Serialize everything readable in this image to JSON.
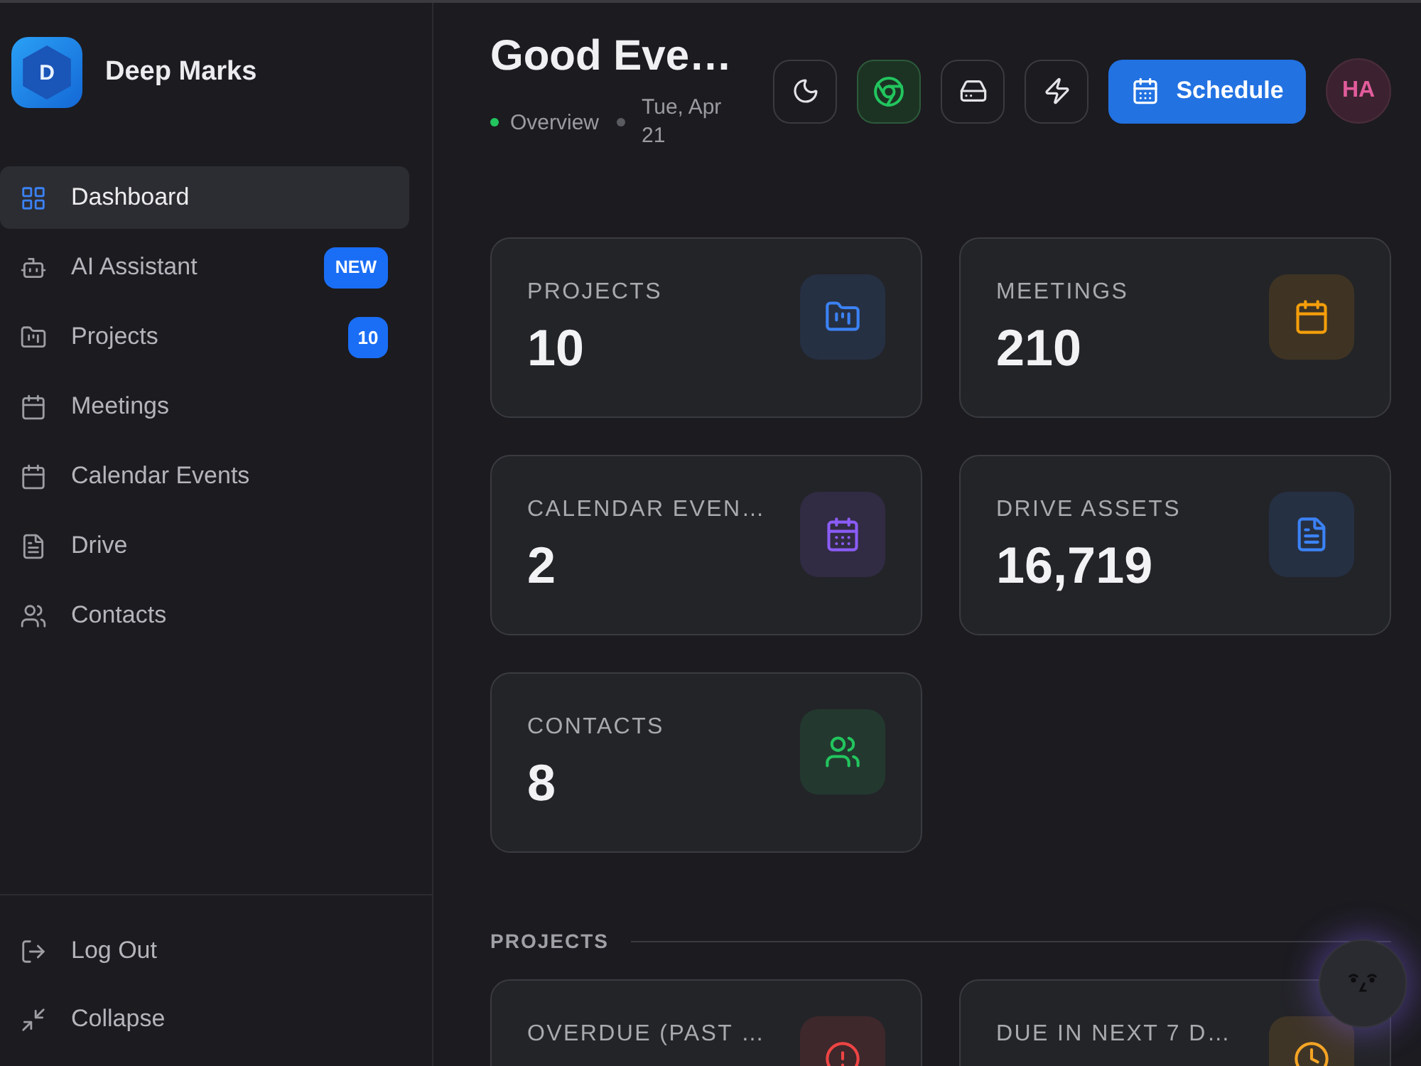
{
  "sidebar": {
    "logo_letter": "D",
    "brand": "Deep Marks",
    "nav": [
      {
        "label": "Dashboard",
        "selected": true
      },
      {
        "label": "AI Assistant",
        "selected": false,
        "badge": "NEW"
      },
      {
        "label": "Projects",
        "selected": false,
        "badge": "10"
      },
      {
        "label": "Meetings",
        "selected": false
      },
      {
        "label": "Calendar Events",
        "selected": false
      },
      {
        "label": "Drive",
        "selected": false
      },
      {
        "label": "Contacts",
        "selected": false
      }
    ],
    "footer": [
      {
        "label": "Log Out"
      },
      {
        "label": "Collapse"
      }
    ]
  },
  "header": {
    "title": "Good Eve…",
    "breadcrumb": "Overview",
    "date": "Tue, Apr 21",
    "tools": [
      {
        "on": false
      },
      {
        "on": true
      },
      {
        "on": false
      },
      {
        "on": false
      }
    ],
    "schedule_button": "Schedule",
    "avatar": "HA"
  },
  "stats": [
    {
      "label": "PROJECTS",
      "value": "10",
      "color": "#3b82f6"
    },
    {
      "label": "MEETINGS",
      "value": "210",
      "color": "#f59e0b"
    },
    {
      "label": "CALENDAR EVEN…",
      "value": "2",
      "color": "#8b5cf6"
    },
    {
      "label": "DRIVE ASSETS",
      "value": "16,719",
      "color": "#3b82f6"
    },
    {
      "label": "CONTACTS",
      "value": "8",
      "color": "#22c55e"
    }
  ],
  "projects": {
    "title": "PROJECTS",
    "cards": [
      {
        "label": "OVERDUE (PAST …",
        "color": "#ef4444"
      },
      {
        "label": "DUE IN NEXT 7 D…",
        "color": "#f5a524"
      }
    ]
  }
}
